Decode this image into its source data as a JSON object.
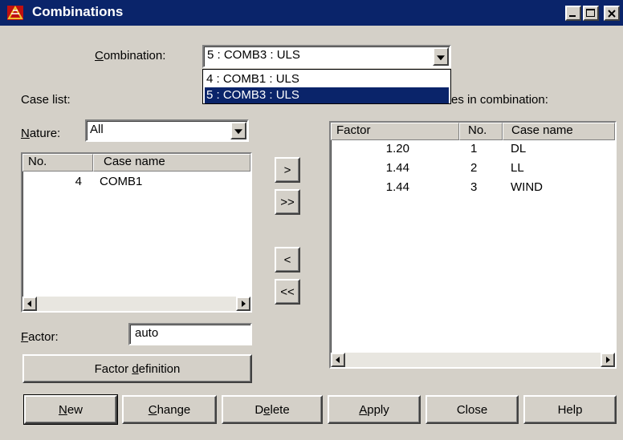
{
  "window": {
    "title": "Combinations",
    "controls": {
      "minimize": "minimize-icon",
      "maximize": "maximize-icon",
      "close": "close-icon"
    }
  },
  "combination": {
    "label_u": "C",
    "label_rest": "ombination:",
    "selected": "5 : COMB3 : ULS",
    "options": [
      "4 : COMB1 : ULS",
      "5 : COMB3 : ULS"
    ]
  },
  "case_list": {
    "label": "Case list:",
    "nature_label_u": "N",
    "nature_label_rest": "ature:",
    "nature_value": "All",
    "columns": [
      "No.",
      "Case name"
    ],
    "rows": [
      {
        "no": "4",
        "name": "COMB1"
      }
    ]
  },
  "transfer": {
    "add": ">",
    "add_all": ">>",
    "remove": "<",
    "remove_all": "<<"
  },
  "in_combination": {
    "label_visible": "es in combination:",
    "columns": [
      "Factor",
      "No.",
      "Case name"
    ],
    "rows": [
      {
        "factor": "1.20",
        "no": "1",
        "name": "DL"
      },
      {
        "factor": "1.44",
        "no": "2",
        "name": "LL"
      },
      {
        "factor": "1.44",
        "no": "3",
        "name": "WIND"
      }
    ]
  },
  "factor": {
    "label_u": "F",
    "label_rest": "actor:",
    "value": "auto",
    "definition_pre": "Factor ",
    "definition_u": "d",
    "definition_post": "efinition"
  },
  "buttons": {
    "new_u": "N",
    "new_rest": "ew",
    "change_u": "C",
    "change_rest": "hange",
    "delete_pre": "D",
    "delete_u": "e",
    "delete_post": "lete",
    "apply_u": "A",
    "apply_rest": "pply",
    "close": "Close",
    "help": "Help"
  },
  "colors": {
    "titlebar": "#0a246a",
    "selection": "#0a246a",
    "face": "#d4d0c8"
  }
}
